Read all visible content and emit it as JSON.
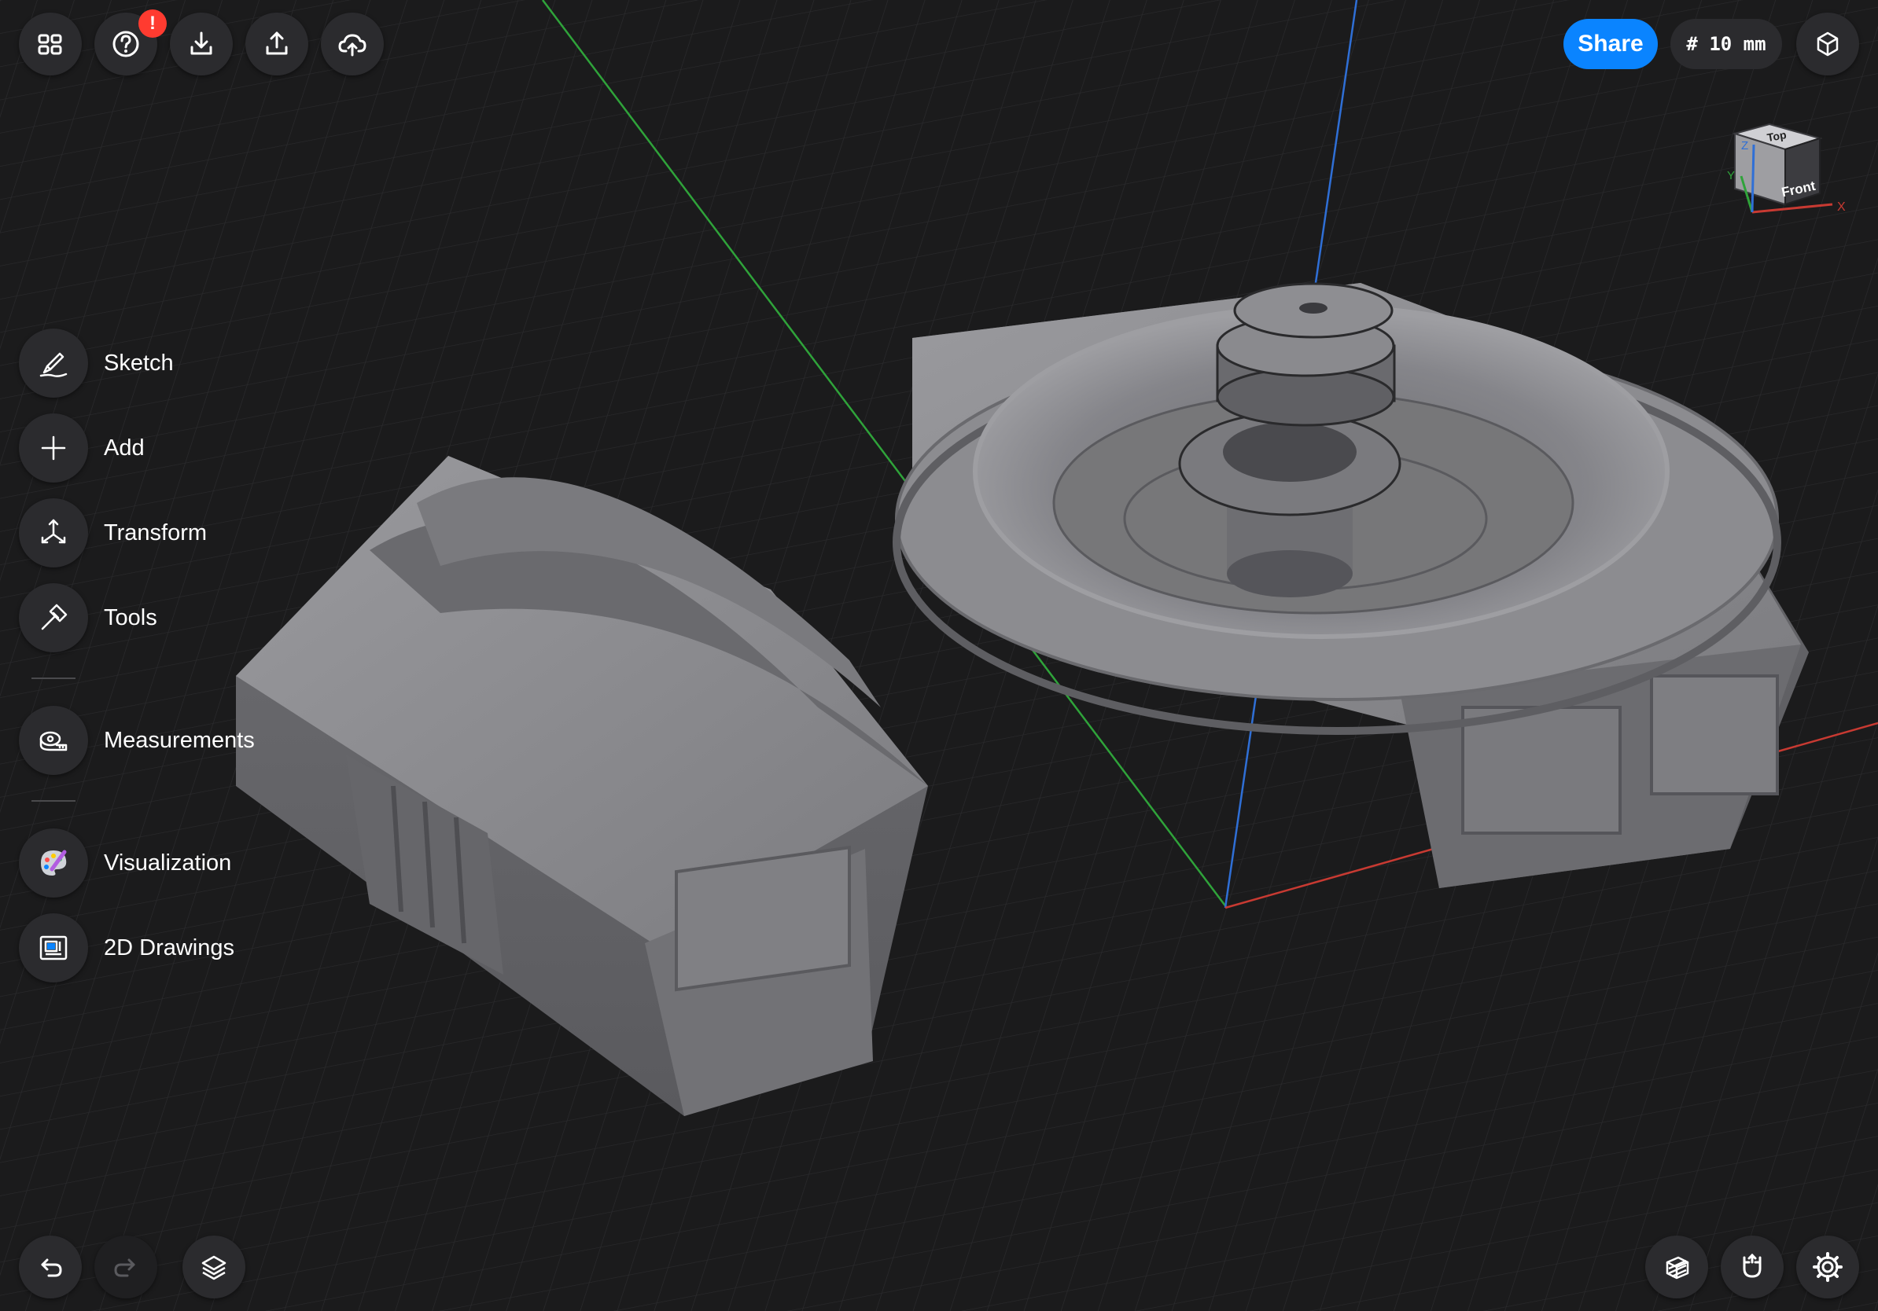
{
  "toolbar": {
    "buttons": [
      {
        "icon": "grid-four-icon"
      },
      {
        "icon": "help-question-icon",
        "badge": "!"
      },
      {
        "icon": "import-download-icon"
      },
      {
        "icon": "export-upload-icon"
      },
      {
        "icon": "cloud-upload-icon"
      }
    ],
    "share_label": "Share",
    "grid_size_label": "# 10 mm",
    "view_icon": "cube-view-icon"
  },
  "view_cube": {
    "top_label": "Top",
    "front_label": "Front",
    "axis_x": "X",
    "axis_y": "Y",
    "axis_z": "Z"
  },
  "sidebar": {
    "items": [
      {
        "label": "Sketch",
        "icon": "sketch-pencil-icon"
      },
      {
        "label": "Add",
        "icon": "plus-icon"
      },
      {
        "label": "Transform",
        "icon": "transform-arrows-icon"
      },
      {
        "label": "Tools",
        "icon": "hammer-icon"
      },
      {
        "label": "Measurements",
        "icon": "tape-measure-icon"
      },
      {
        "label": "Visualization",
        "icon": "palette-brush-icon"
      },
      {
        "label": "2D Drawings",
        "icon": "blueprint-icon"
      }
    ]
  },
  "bottom_left": [
    {
      "icon": "undo-icon"
    },
    {
      "icon": "redo-icon",
      "enabled": false
    },
    {
      "icon": "layers-icon"
    }
  ],
  "bottom_right": [
    {
      "icon": "section-plane-icon"
    },
    {
      "icon": "magnet-snap-icon"
    },
    {
      "icon": "settings-gear-icon"
    }
  ],
  "colors": {
    "background": "#1b1b1c",
    "button": "#2b2b2e",
    "accent": "#0a84ff",
    "badge": "#ff3b30",
    "axis_x": "#c83a32",
    "axis_y": "#2fa33a",
    "axis_z": "#2f6fd6",
    "model": "#8a8a8e"
  }
}
